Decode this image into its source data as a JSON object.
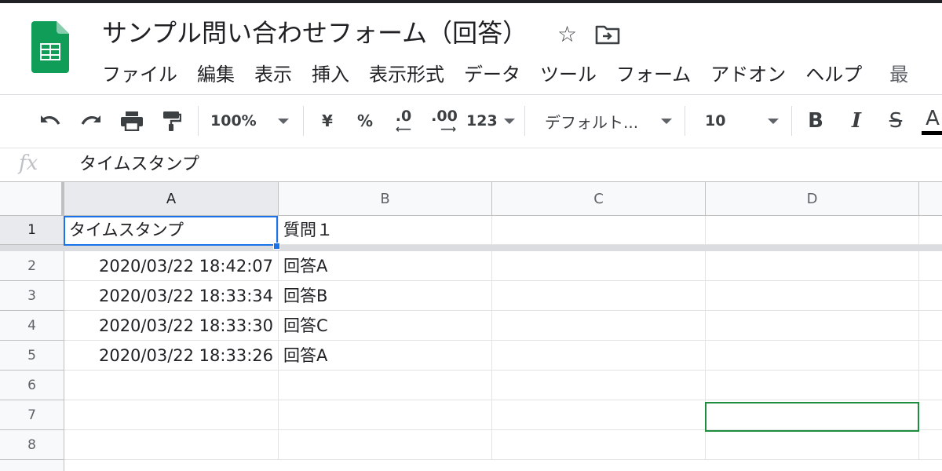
{
  "app": {
    "title": "サンプル問い合わせフォーム（回答）",
    "icons": {
      "star": "star-icon",
      "folder": "move-to-folder-icon",
      "logo": "google-sheets-logo"
    },
    "accent": "#1a73e8",
    "collab_color": "#1e8e3e"
  },
  "menu": [
    "ファイル",
    "編集",
    "表示",
    "挿入",
    "表示形式",
    "データ",
    "ツール",
    "フォーム",
    "アドオン",
    "ヘルプ"
  ],
  "menu_overflow": "最",
  "toolbar": {
    "zoom": "100%",
    "currency": "¥",
    "percent": "%",
    "decimal_decrease": ".0",
    "decimal_increase": ".00",
    "more_formats": "123",
    "font": "デフォルト...",
    "font_size": "10",
    "bold": "B",
    "italic": "I",
    "strike": "S",
    "text_color": "A"
  },
  "formula_bar": {
    "fx": "fx",
    "content": "タイムスタンプ"
  },
  "columns": [
    "A",
    "B",
    "C",
    "D"
  ],
  "rows": [
    "1",
    "2",
    "3",
    "4",
    "5",
    "6",
    "7",
    "8"
  ],
  "cells": {
    "A1": "タイムスタンプ",
    "B1": "質問１",
    "A2": "2020/03/22 18:42:07",
    "B2": "回答A",
    "A3": "2020/03/22 18:33:34",
    "B3": "回答B",
    "A4": "2020/03/22 18:33:30",
    "B4": "回答C",
    "A5": "2020/03/22 18:33:26",
    "B5": "回答A"
  }
}
